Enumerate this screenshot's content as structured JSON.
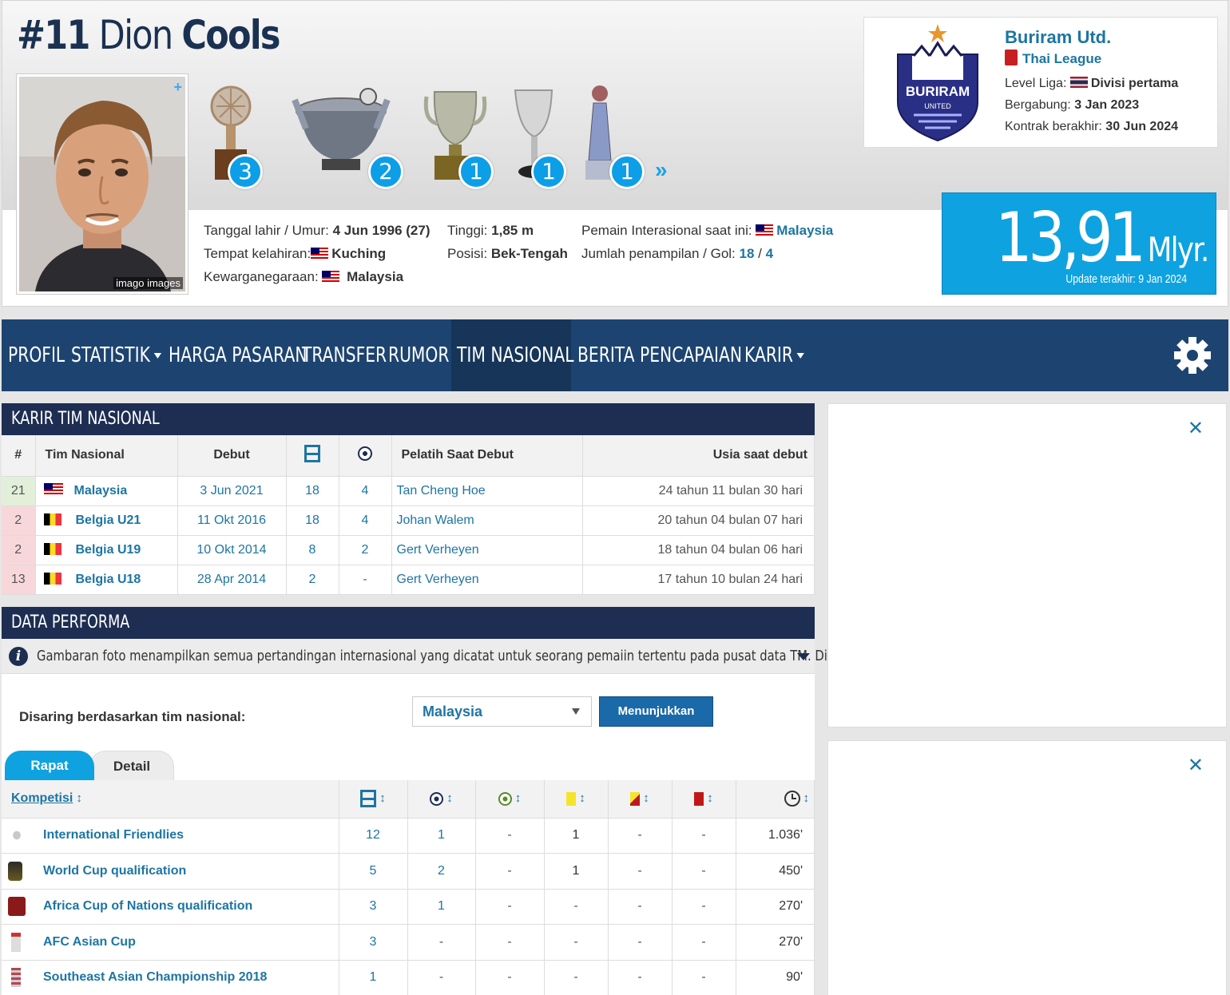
{
  "player": {
    "number": "#11",
    "first_name": "Dion",
    "last_name": "Cools",
    "photo_credit": "imago images"
  },
  "trophies": [
    {
      "icon": "trophy-icon",
      "count": "3"
    },
    {
      "icon": "trophy-icon",
      "count": "2"
    },
    {
      "icon": "trophy-icon",
      "count": "1"
    },
    {
      "icon": "trophy-icon",
      "count": "1"
    },
    {
      "icon": "trophy-icon",
      "count": "1"
    }
  ],
  "trophy_more": "»",
  "details": {
    "birth_label": "Tanggal lahir / Umur:",
    "birth_value": "4 Jun 1996 (27)",
    "birthplace_label": "Tempat kelahiran:",
    "birthplace_value": "Kuching",
    "citizenship_label": "Kewarganegaraan:",
    "citizenship_value": "Malaysia",
    "height_label": "Tinggi:",
    "height_value": "1,85 m",
    "position_label": "Posisi:",
    "position_value": "Bek-Tengah",
    "intl_label": "Pemain Interasional saat ini:",
    "intl_value": "Malaysia",
    "caps_label": "Jumlah penampilan / Gol:",
    "caps_value": "18",
    "caps_sep": "/",
    "goals_value": "4"
  },
  "club": {
    "name": "Buriram Utd.",
    "league": "Thai League",
    "logo_text": "BURIRAM",
    "logo_sub": "UNITED",
    "level_label": "Level Liga:",
    "level_value": "Divisi pertama",
    "joined_label": "Bergabung:",
    "joined_value": "3 Jan 2023",
    "contract_label": "Kontrak berakhir:",
    "contract_value": "30 Jun 2024"
  },
  "market_value": {
    "amount": "13,91",
    "unit": "Mlyr.",
    "update": "Update terakhir: 9 Jan 2024"
  },
  "nav": {
    "items": [
      "PROFIL",
      "STATISTIK",
      "HARGA PASARAN",
      "TRANSFER",
      "RUMOR",
      "TIM NASIONAL",
      "BERITA",
      "PENCAPAIAN",
      "KARIR"
    ],
    "active": "TIM NASIONAL"
  },
  "career": {
    "title": "KARIR TIM NASIONAL",
    "headers": {
      "rank": "#",
      "team": "Tim Nasional",
      "debut": "Debut",
      "coach": "Pelatih Saat Debut",
      "age": "Usia saat debut"
    },
    "rows": [
      {
        "rank": "21",
        "team": "Malaysia",
        "flag": "malaysia",
        "debut": "3 Jun 2021",
        "apps": "18",
        "goals": "4",
        "coach": "Tan Cheng Hoe",
        "age": "24 tahun 11 bulan 30 hari"
      },
      {
        "rank": "2",
        "team": "Belgia U21",
        "flag": "belgium",
        "debut": "11 Okt 2016",
        "apps": "18",
        "goals": "4",
        "coach": "Johan Walem",
        "age": "20 tahun 04 bulan 07 hari"
      },
      {
        "rank": "2",
        "team": "Belgia U19",
        "flag": "belgium",
        "debut": "10 Okt 2014",
        "apps": "8",
        "goals": "2",
        "coach": "Gert Verheyen",
        "age": "18 tahun 04 bulan 06 hari"
      },
      {
        "rank": "13",
        "team": "Belgia U18",
        "flag": "belgium",
        "debut": "28 Apr 2014",
        "apps": "2",
        "goals": "-",
        "coach": "Gert Verheyen",
        "age": "17 tahun 10 bulan 24 hari"
      }
    ]
  },
  "performance": {
    "title": "DATA PERFORMA",
    "info_text": "Gambaran foto menampilkan semua pertandingan internasional yang dicatat untuk seorang pemaiin tertentu pada pusat data TM. Dibawah \"Di...",
    "filter_label": "Disaring berdasarkan tim nasional:",
    "filter_value": "Malaysia",
    "filter_button": "Menunjukkan",
    "tabs": [
      "Rapat",
      "Detail"
    ],
    "comp_header": "Kompetisi",
    "sort_glyph": "↕",
    "rows": [
      {
        "name": "International Friendlies",
        "apps": "12",
        "goals": "1",
        "assists": "-",
        "yellow": "1",
        "yellowred": "-",
        "red": "-",
        "minutes": "1.036'"
      },
      {
        "name": "World Cup qualification",
        "apps": "5",
        "goals": "2",
        "assists": "-",
        "yellow": "1",
        "yellowred": "-",
        "red": "-",
        "minutes": "450'"
      },
      {
        "name": "Africa Cup of Nations qualification",
        "apps": "3",
        "goals": "1",
        "assists": "-",
        "yellow": "-",
        "yellowred": "-",
        "red": "-",
        "minutes": "270'"
      },
      {
        "name": "AFC Asian Cup",
        "apps": "3",
        "goals": "-",
        "assists": "-",
        "yellow": "-",
        "yellowred": "-",
        "red": "-",
        "minutes": "270'"
      },
      {
        "name": "Southeast Asian Championship 2018",
        "apps": "1",
        "goals": "-",
        "assists": "-",
        "yellow": "-",
        "yellowred": "-",
        "red": "-",
        "minutes": "90'"
      }
    ]
  },
  "ads": {
    "close": "✕"
  },
  "colors": {
    "brand": "#1d2e52",
    "nav": "#1d4470",
    "accent": "#0ea2e0",
    "link": "#1d75a3"
  }
}
